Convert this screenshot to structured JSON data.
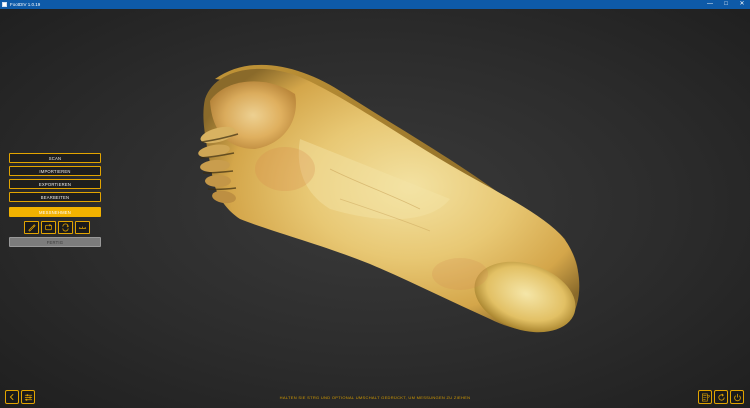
{
  "window": {
    "title": "FootDIV 1.0.19",
    "controls": [
      "—",
      "□",
      "✕"
    ]
  },
  "menu": {
    "scan": "SCAN",
    "import": "IMPORTIEREN",
    "export": "EXPORTIEREN",
    "edit": "BEARBEITEN",
    "measure": "MESSNEHMEN",
    "confirm": "FERTIG"
  },
  "tools": [
    "pen-icon",
    "loop-icon",
    "cycle-icon",
    "ruler-icon"
  ],
  "bottom_left": [
    "back-icon",
    "settings-sliders-icon"
  ],
  "bottom_right": [
    "help-document-icon",
    "refresh-icon",
    "power-icon"
  ],
  "status": {
    "message": "HALTEN SIE STRG UND OPTIONAL UMSCHALT GEDRÜCKT, UM MESSUNGEN ZU ZIEHEN"
  },
  "colors": {
    "accent": "#e2a400",
    "accent_active": "#f2b200",
    "titlebar": "#0e5aa8",
    "background": "#2c2c2c"
  }
}
